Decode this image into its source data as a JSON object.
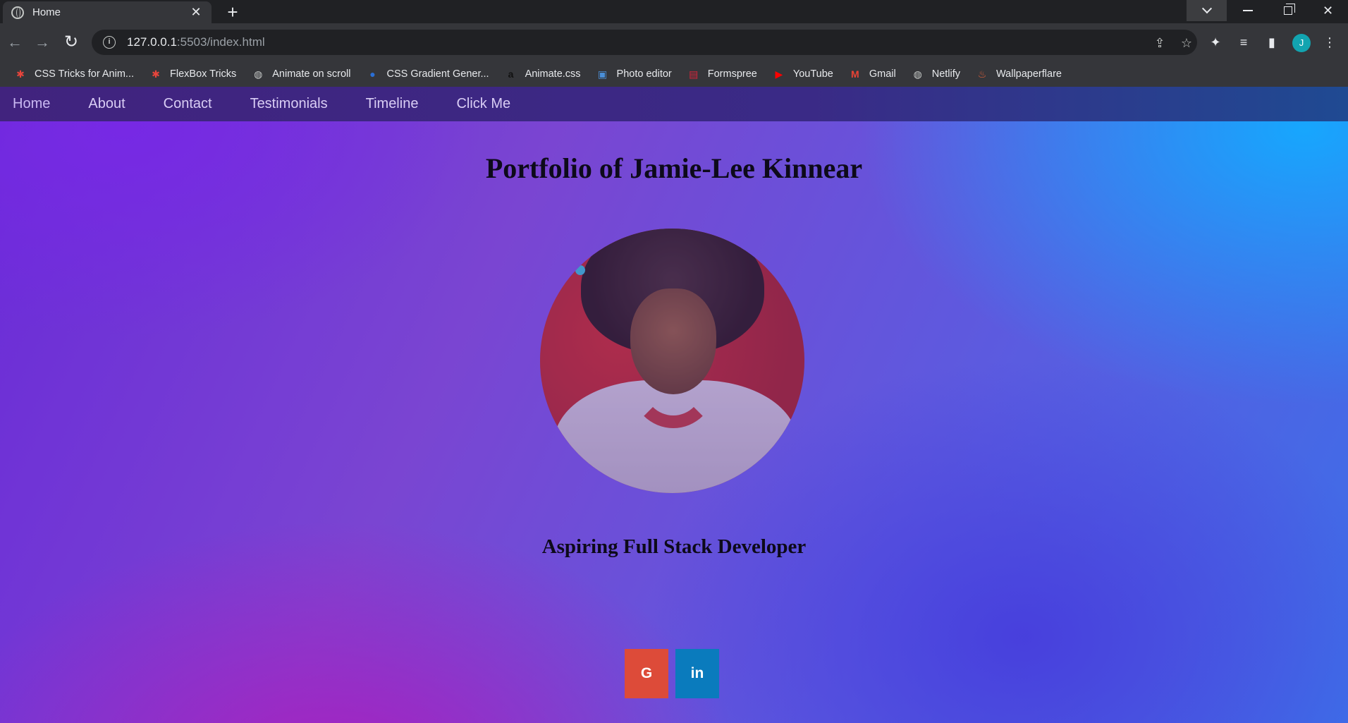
{
  "browser": {
    "tab_title": "Home",
    "url_host": "127.0.0.1",
    "url_rest": ":5503/index.html",
    "avatar_letter": "J",
    "avatar_color": "#12a4b0",
    "bookmarks": [
      {
        "label": "CSS Tricks for Anim...",
        "icon": "asterisk-icon",
        "color": "#e8453c"
      },
      {
        "label": "FlexBox Tricks",
        "icon": "asterisk-icon",
        "color": "#e8453c"
      },
      {
        "label": "Animate on scroll",
        "icon": "globe-icon",
        "color": "#c4c7c5"
      },
      {
        "label": "CSS Gradient Gener...",
        "icon": "gradient-icon",
        "color": "#2a6fd6"
      },
      {
        "label": "Animate.css",
        "icon": "animate-icon",
        "color": "#111111"
      },
      {
        "label": "Photo editor",
        "icon": "photo-editor-icon",
        "color": "#4a8fd8"
      },
      {
        "label": "Formspree",
        "icon": "formspree-icon",
        "color": "#d6243a"
      },
      {
        "label": "YouTube",
        "icon": "youtube-icon",
        "color": "#ff0000"
      },
      {
        "label": "Gmail",
        "icon": "gmail-icon",
        "color": "#ea4335"
      },
      {
        "label": "Netlify",
        "icon": "globe-icon",
        "color": "#c4c7c5"
      },
      {
        "label": "Wallpaperflare",
        "icon": "flame-icon",
        "color": "#e0603a"
      }
    ]
  },
  "site": {
    "nav": [
      "Home",
      "About",
      "Contact",
      "Testimonials",
      "Timeline",
      "Click Me"
    ],
    "title": "Portfolio of Jamie-Lee Kinnear",
    "subtitle": "Aspiring Full Stack Developer",
    "social": {
      "google_label": "G",
      "linkedin_label": "in",
      "google_color": "#dd4b39",
      "linkedin_color": "#0a7bbd"
    }
  }
}
